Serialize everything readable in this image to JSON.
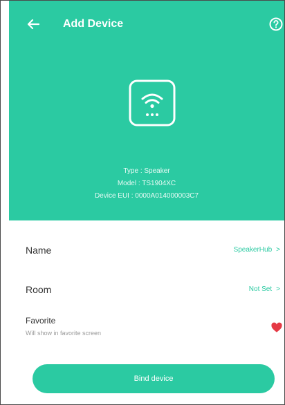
{
  "header": {
    "title": "Add Device",
    "back_icon": "arrow-left-icon",
    "help_icon": "help-circle-icon"
  },
  "device": {
    "icon": "wifi-device-icon",
    "type_line": "Type : Speaker",
    "model_line": "Model : TS1904XC",
    "device_eui_line": "Device EUI : 0000A014000003C7"
  },
  "settings": {
    "name": {
      "label": "Name",
      "value": "SpeakerHub",
      "chevron": ">"
    },
    "room": {
      "label": "Room",
      "value": "Not Set",
      "chevron": ">"
    },
    "favorite": {
      "label": "Favorite",
      "hint": "Will show in favorite screen",
      "icon": "heart-icon",
      "active": true
    }
  },
  "actions": {
    "bind_label": "Bind device"
  },
  "colors": {
    "accent": "#2bcaa2",
    "heart": "#e53945"
  }
}
